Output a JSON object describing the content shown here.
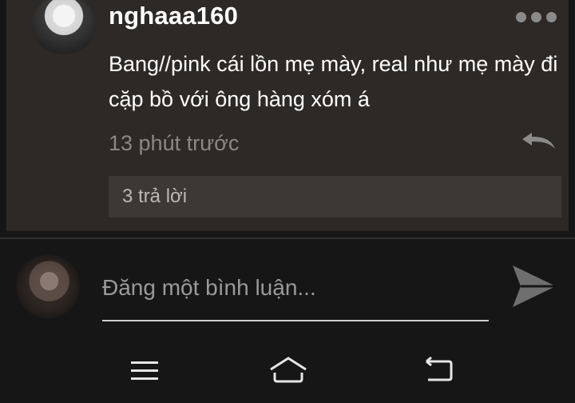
{
  "comment": {
    "username": "nghaaa160",
    "text": "Bang//pink cái lồn mẹ mày, real như mẹ mày đi cặp bồ với ông hàng xóm á",
    "timestamp": "13 phút trước",
    "replies_label": "3 trả lời",
    "more_icon": "more-horizontal-icon",
    "reply_icon": "reply-arrow-icon"
  },
  "composer": {
    "placeholder": "Đăng một bình luận...",
    "value": "",
    "send_icon": "send-icon"
  },
  "navigation": {
    "icons": [
      "menu-icon",
      "home-icon",
      "back-icon"
    ]
  },
  "colors": {
    "background": "#161616",
    "card": "#2d2926",
    "replies_bar": "#3b3835",
    "text_primary": "#ffffff",
    "text_secondary": "#8c8782"
  }
}
